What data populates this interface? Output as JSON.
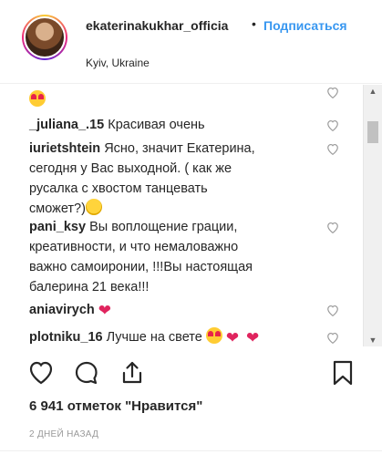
{
  "header": {
    "username": "ekaterinakukhar_officia",
    "separator": "•",
    "follow_label": "Подписаться",
    "location": "Kyiv, Ukraine"
  },
  "comments": [
    {
      "user": "_juliana_.15",
      "text": "Красивая очень"
    },
    {
      "user": "iurietshtein",
      "text_line1": "Ясно, значит Екатерина,",
      "text_line2": "сегодня у Вас выходной. ( как же",
      "text_line3": "русалка с хвостом танцевать",
      "text_line4": "сможет?)"
    },
    {
      "user": "pani_ksy",
      "text_line1": "Вы воплощение грации,",
      "text_line2": "креативности, и что немаловажно",
      "text_line3": "важно самоиронии, !!!Вы настоящая",
      "text_line4": "балерина 21 века!!!"
    },
    {
      "user": "aniavirych",
      "text": ""
    },
    {
      "user": "plotniku_16",
      "text": "Лучше на свете"
    }
  ],
  "likes": "6 941 отметок \"Нравится\"",
  "time_ago": "2 ДНЕЙ НАЗАД",
  "colors": {
    "link": "#3897f0",
    "text": "#262626",
    "muted": "#999999"
  },
  "icons": [
    "heart-icon",
    "comment-icon",
    "share-icon",
    "bookmark-icon",
    "scroll-up-arrow-icon",
    "scroll-down-arrow-icon"
  ]
}
